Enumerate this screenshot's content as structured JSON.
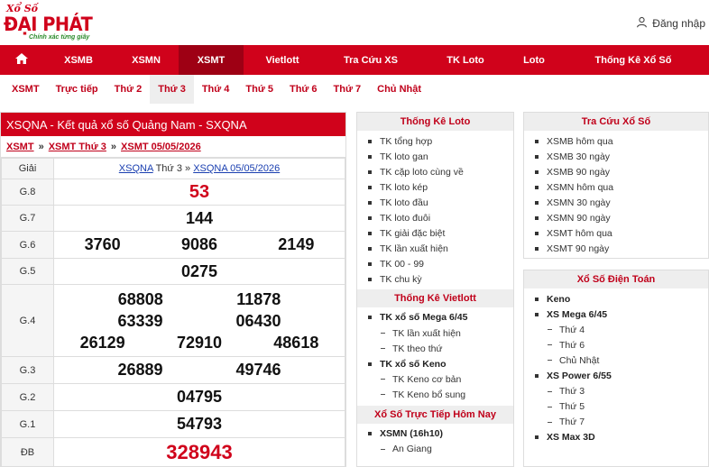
{
  "header": {
    "logo_small": "Xổ Số",
    "logo_big": "ĐẠI PHÁT",
    "logo_slogan": "Chính xác từng giây",
    "login_label": "Đăng nhập"
  },
  "main_nav": [
    "XSMB",
    "XSMN",
    "XSMT",
    "Vietlott",
    "Tra Cứu XS",
    "TK Loto",
    "Loto",
    "Thống Kê Xổ Số"
  ],
  "main_nav_active": "XSMT",
  "sub_nav": [
    "XSMT",
    "Trực tiếp",
    "Thứ 2",
    "Thứ 3",
    "Thứ 4",
    "Thứ 5",
    "Thứ 6",
    "Thứ 7",
    "Chủ Nhật"
  ],
  "sub_nav_active": "Thứ 3",
  "results": {
    "title": "XSQNA - Kết quả xổ số Quảng Nam - SXQNA",
    "crumbs": [
      "XSMT",
      "XSMT Thứ 3",
      "XSMT 05/05/2026"
    ],
    "crumb_sep": "»",
    "header_label": "Giải",
    "header_link1": "XSQNA",
    "header_mid": "Thứ 3",
    "header_sep": "»",
    "header_link2": "XSQNA 05/05/2026",
    "prizes": {
      "g8": {
        "label": "G.8",
        "nums": [
          "53"
        ]
      },
      "g7": {
        "label": "G.7",
        "nums": [
          "144"
        ]
      },
      "g6": {
        "label": "G.6",
        "nums": [
          "3760",
          "9086",
          "2149"
        ]
      },
      "g5": {
        "label": "G.5",
        "nums": [
          "0275"
        ]
      },
      "g4": {
        "label": "G.4",
        "nums": [
          "68808",
          "11878",
          "63339",
          "06430",
          "26129",
          "72910",
          "48618"
        ]
      },
      "g3": {
        "label": "G.3",
        "nums": [
          "26889",
          "49746"
        ]
      },
      "g2": {
        "label": "G.2",
        "nums": [
          "04795"
        ]
      },
      "g1": {
        "label": "G.1",
        "nums": [
          "54793"
        ]
      },
      "db": {
        "label": "ĐB",
        "nums": [
          "328943"
        ]
      }
    }
  },
  "tk_loto": {
    "title": "Thống Kê Loto",
    "items": [
      "TK tổng hợp",
      "TK loto gan",
      "TK cặp loto cùng về",
      "TK loto kép",
      "TK loto đầu",
      "TK loto đuôi",
      "TK giải đặc biệt",
      "TK lần xuất hiện",
      "TK 00 - 99",
      "TK chu kỳ"
    ]
  },
  "tk_vietlott": {
    "title": "Thống Kê Vietlott",
    "mega_label": "TK xổ số Mega 6/45",
    "mega_items": [
      "TK lần xuất hiện",
      "TK theo thứ"
    ],
    "keno_label": "TK xổ số Keno",
    "keno_items": [
      "TK Keno cơ bản",
      "TK Keno bổ sung"
    ]
  },
  "xs_truc_tiep": {
    "title": "Xổ Số Trực Tiếp Hôm Nay",
    "items": [
      "XSMN (16h10)"
    ],
    "partial_text": "An Giang"
  },
  "tra_cuu": {
    "title": "Tra Cứu Xổ Số",
    "items": [
      "XSMB hôm qua",
      "XSMB 30 ngày",
      "XSMB 90 ngày",
      "XSMN hôm qua",
      "XSMN 30 ngày",
      "XSMN 90 ngày",
      "XSMT hôm qua",
      "XSMT 90 ngày"
    ]
  },
  "dien_toan": {
    "title": "Xổ Số Điện Toán",
    "keno": "Keno",
    "mega_label": "XS Mega 6/45",
    "mega_items": [
      "Thứ 4",
      "Thứ 6",
      "Chủ Nhật"
    ],
    "power_label": "XS Power 6/55",
    "power_items": [
      "Thứ 3",
      "Thứ 5",
      "Thứ 7"
    ],
    "max3d": "XS Max 3D"
  },
  "colors": {
    "brand_red": "#d0021b",
    "nav_active": "#9e0014",
    "logo_green": "#2a8a2a"
  }
}
